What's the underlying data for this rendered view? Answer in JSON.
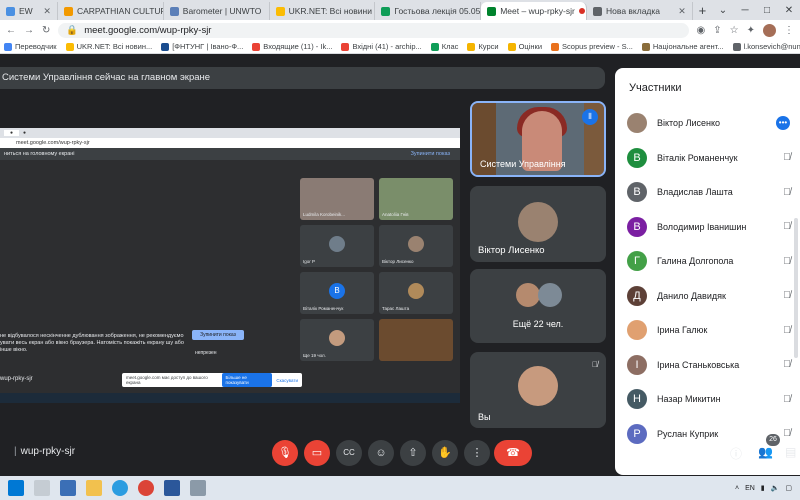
{
  "browser": {
    "tabs": [
      {
        "label": "EW",
        "color": "#4a90e2"
      },
      {
        "label": "CARPATHIAN CULTURAL",
        "color": "#f29900"
      },
      {
        "label": "Barometer | UNWTO",
        "color": "#5b7fb8"
      },
      {
        "label": "UKR.NET: Всі новини Ук",
        "color": "#fbbc04"
      },
      {
        "label": "Гостьова лекція 05.05.",
        "color": "#0f9d58"
      },
      {
        "label": "Meet – wup-rpky-sjr",
        "color": "#00832d",
        "active": true
      },
      {
        "label": "Нова вкладка",
        "color": "#5f6368"
      }
    ],
    "new_tab": "+",
    "url": "meet.google.com/wup-rpky-sjr",
    "bookmarks": [
      {
        "label": "Переводчик",
        "color": "#4285f4"
      },
      {
        "label": "UKR.NET: Всі новин...",
        "color": "#fbbc04"
      },
      {
        "label": "[ФНТУНГ | Івано-Ф...",
        "color": "#1a4d8f"
      },
      {
        "label": "Входящие (11) - Ik...",
        "color": "#ea4335"
      },
      {
        "label": "Вхідні (41) - archip...",
        "color": "#ea4335"
      },
      {
        "label": "Клас",
        "color": "#0f9d58"
      },
      {
        "label": "Курси",
        "color": "#f4b400"
      },
      {
        "label": "Оцінки",
        "color": "#f4b400"
      },
      {
        "label": "Scopus preview - S...",
        "color": "#e9711c"
      },
      {
        "label": "Національне агент...",
        "color": "#8a6d3b"
      },
      {
        "label": "l.konsevich@nung.e...",
        "color": "#5f6368"
      }
    ]
  },
  "meet": {
    "presenting_banner": "Системи Управління сейчас на главном экране",
    "meeting_code": "wup-rpky-sjr",
    "speaker_tile_name": "Системи Управління",
    "tile_viktor": "Віктор Лисенко",
    "more_people": "Ещё 22 чел.",
    "you_label": "Вы",
    "participant_count": "26"
  },
  "shared_screen": {
    "addr": "meet.google.com/wup-rpky-sjr",
    "banner": "ниться на головному екрані",
    "stop_label": "Зупинити показ",
    "tiles": [
      {
        "name": "Ludmila Korobeinik...",
        "type": "video"
      },
      {
        "name": "Anatoliia Гнів",
        "type": "video"
      },
      {
        "name": "Igor P",
        "type": "avatar"
      },
      {
        "name": "Віктор Лисенко",
        "type": "avatar"
      },
      {
        "name": "Віталік Романенчук",
        "type": "letter",
        "letter": "В"
      },
      {
        "name": "Тарас Лашта",
        "type": "avatar"
      },
      {
        "name": "Ще 19 чол.",
        "type": "avatar"
      },
      {
        "name": "",
        "type": "video"
      }
    ],
    "warning": "не відбувалося нескінченне дублювання зображення, не рекомендуємо увати весь екран або вікно браузера. Натомість покажіть екрану шу або інше вікно.",
    "stop_button": "Зупинити показ",
    "present_label": "непрезен",
    "code": "wup-rpky-sjr",
    "popup_text": "meet.google.com має доступ до вашого екрана",
    "popup_hide": "Більше не показувати",
    "popup_stop": "Скасувати"
  },
  "participants_panel": {
    "title": "Участники",
    "people": [
      {
        "name": "Віктор Лисенко",
        "type": "photo",
        "color": "#9a8270",
        "state": "more"
      },
      {
        "name": "Віталік Романенчук",
        "type": "letter",
        "letter": "В",
        "color": "#1e8e3e",
        "state": "muted"
      },
      {
        "name": "Владислав Лашта",
        "type": "letter",
        "letter": "В",
        "color": "#5f6368",
        "state": "muted"
      },
      {
        "name": "Володимир Іванишин",
        "type": "letter",
        "letter": "В",
        "color": "#7b1fa2",
        "state": "muted"
      },
      {
        "name": "Галина Долгопола",
        "type": "letter",
        "letter": "Г",
        "color": "#43a047",
        "state": "muted"
      },
      {
        "name": "Данило Давидяк",
        "type": "letter",
        "letter": "Д",
        "color": "#5d4037",
        "state": "muted"
      },
      {
        "name": "Ірина Галюк",
        "type": "photo",
        "color": "#e0a070",
        "state": "muted"
      },
      {
        "name": "Ірина Станьковська",
        "type": "letter",
        "letter": "І",
        "color": "#8d6e63",
        "state": "muted"
      },
      {
        "name": "Назар Микитин",
        "type": "letter",
        "letter": "Н",
        "color": "#455a64",
        "state": "muted"
      },
      {
        "name": "Руслан Куприк",
        "type": "letter",
        "letter": "Р",
        "color": "#5c6bc0",
        "state": "muted"
      }
    ]
  },
  "taskbar": {
    "lang": "EN"
  }
}
